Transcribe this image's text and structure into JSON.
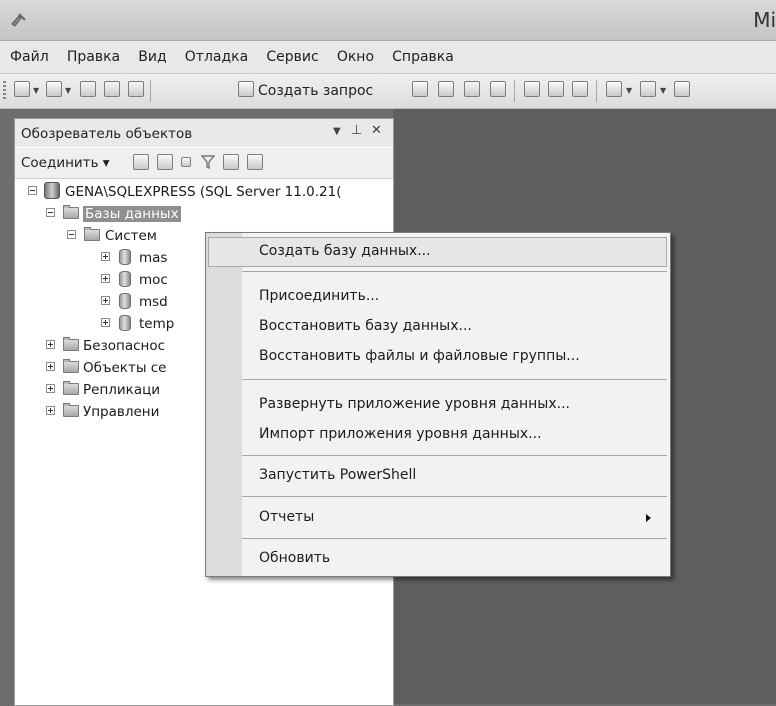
{
  "window": {
    "title": "Mi"
  },
  "menu": [
    "Файл",
    "Правка",
    "Вид",
    "Отладка",
    "Сервис",
    "Окно",
    "Справка"
  ],
  "toolbar": {
    "new_query_label": "Создать запрос"
  },
  "object_explorer": {
    "title": "Обозреватель объектов",
    "pin_symbol": "▾ ⫮ ✕",
    "connect_label": "Соединить ▾",
    "tree": {
      "server": "GENA\\SQLEXPRESS (SQL Server 11.0.21(",
      "databases": "Базы данных",
      "system_databases": "Систем",
      "db_items": [
        "mas",
        "moc",
        "msd",
        "temp"
      ],
      "folders": [
        "Безопаснос",
        "Объекты се",
        "Репликаци",
        "Управлени"
      ]
    }
  },
  "context_menu": {
    "items": [
      "Создать базу данных...",
      "Присоединить...",
      "Восстановить базу данных...",
      "Восстановить файлы и файловые группы...",
      "Развернуть приложение уровня данных...",
      "Импорт приложения уровня данных...",
      "Запустить PowerShell",
      "Отчеты",
      "Обновить"
    ]
  }
}
